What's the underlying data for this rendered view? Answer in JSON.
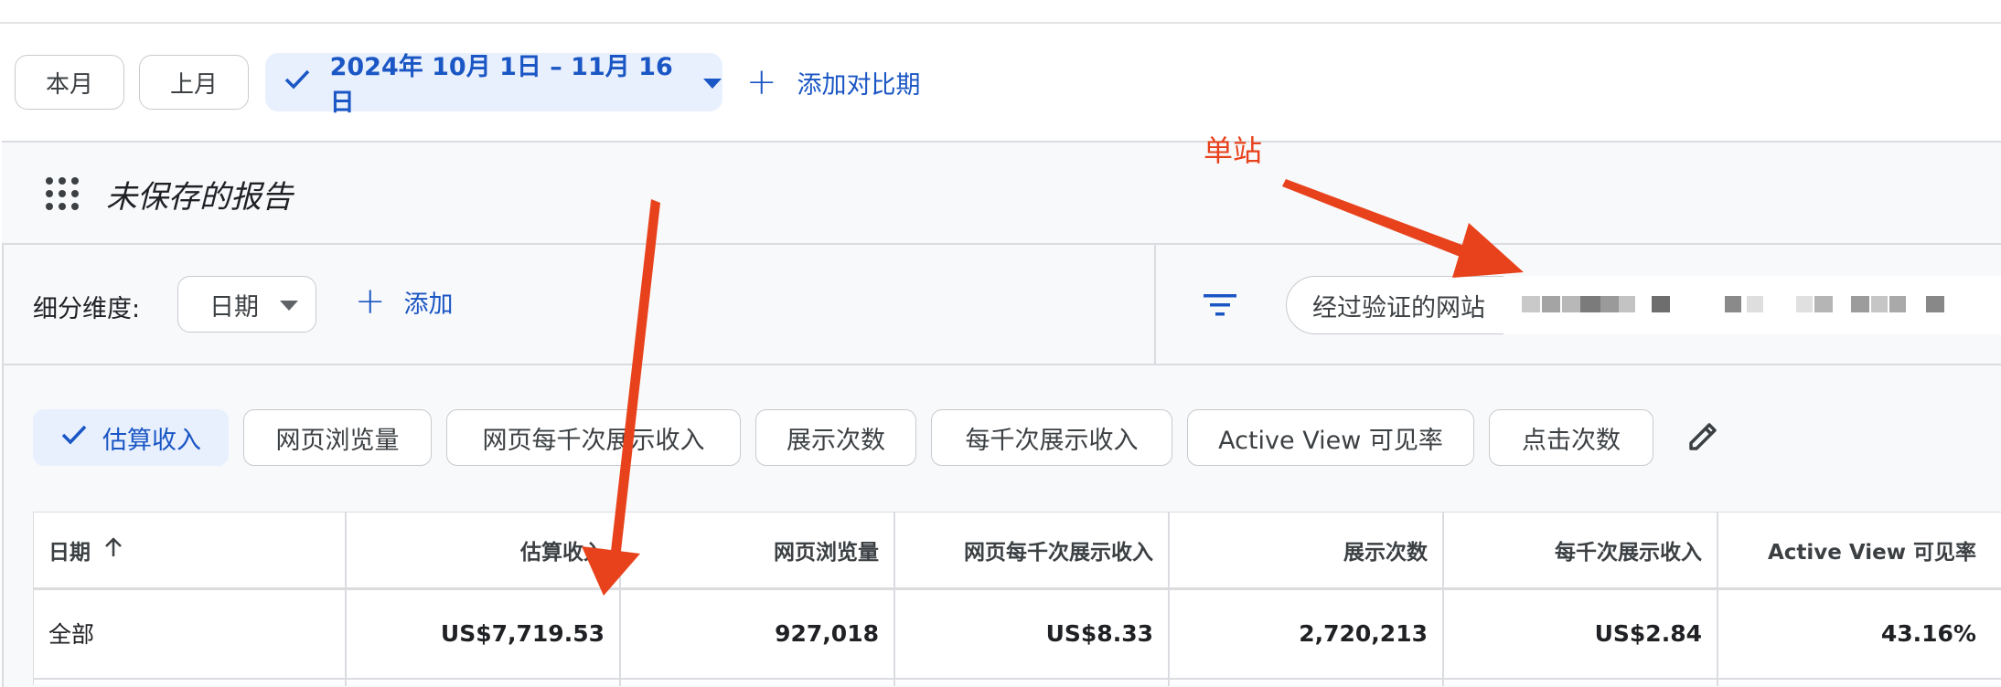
{
  "range_bar": {
    "this_month": "本月",
    "last_month": "上月",
    "date_range": "2024年 10月 1日 – 11月 16日",
    "add_comparison": "添加对比期"
  },
  "report": {
    "title": "未保存的报告"
  },
  "breakdown": {
    "label": "细分维度:",
    "selected": "日期",
    "add_label": "添加"
  },
  "filter": {
    "label": "经过验证的网站"
  },
  "metrics": {
    "chips": [
      "估算收入",
      "网页浏览量",
      "网页每千次展示收入",
      "展示次数",
      "每千次展示收入",
      "Active View 可见率",
      "点击次数"
    ]
  },
  "table": {
    "headers": [
      "日期",
      "估算收入",
      "网页浏览量",
      "网页每千次展示收入",
      "展示次数",
      "每千次展示收入",
      "Active View 可见率"
    ],
    "rows": [
      [
        "全部",
        "US$7,719.53",
        "927,018",
        "US$8.33",
        "2,720,213",
        "US$2.84",
        "43.16%"
      ]
    ]
  },
  "annotation": {
    "text": "单站",
    "color": "#e8421c"
  },
  "colors": {
    "accent_blue": "#1a56c4",
    "selected_chip_bg": "#e8f0fe"
  }
}
